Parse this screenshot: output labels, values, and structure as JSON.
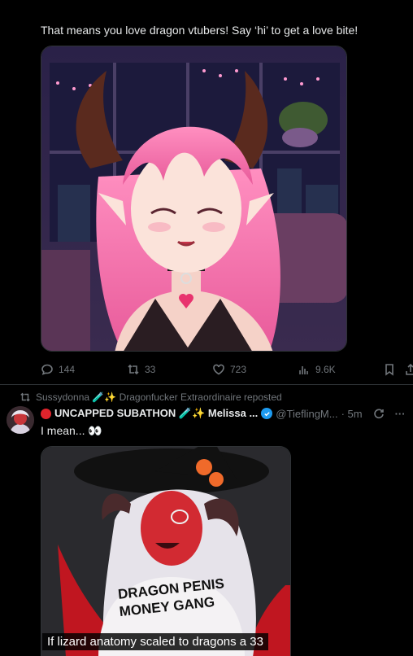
{
  "tweet1": {
    "text": "That means you love dragon vtubers! Say ‘hi’ to get a love bite!",
    "image_alt": "pink-haired dragon vtuber avatar",
    "actions": {
      "replies": "144",
      "reposts": "33",
      "likes": "723",
      "views": "9.6K"
    }
  },
  "tweet2": {
    "repost_label": "Sussydonna 🧪✨ Dragonfucker Extraordinaire reposted",
    "author_name": "UNCAPPED SUBATHON 🧪✨ Melissa ...",
    "author_handle": "@TieflingM...",
    "time": "· 5m",
    "text": "I mean... 👀",
    "image_alt": "red demon illustration with shirt text",
    "shirt_text": "DRAGON PENIS MONEY GANG",
    "caption": "If lizard anatomy scaled to dragons a 33"
  },
  "colors": {
    "background": "#000000",
    "text": "#e7e9ea",
    "muted": "#71767b",
    "verified": "#1d9bf0",
    "border": "#2f3336"
  }
}
